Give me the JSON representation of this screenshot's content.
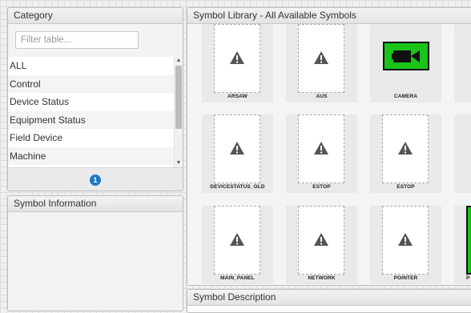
{
  "category": {
    "title": "Category",
    "filter_placeholder": "Filter table...",
    "items": [
      "ALL",
      "Control",
      "Device Status",
      "Equipment Status",
      "Field Device",
      "Machine"
    ],
    "page": "1"
  },
  "symbol_info": {
    "title": "Symbol Information"
  },
  "library": {
    "title": "Symbol Library - All Available Symbols",
    "symbols": [
      {
        "label": "ARSAW",
        "icon": "warning-icon"
      },
      {
        "label": "AUS",
        "icon": "warning-icon"
      },
      {
        "label": "CAMERA",
        "icon": "camera-icon"
      },
      {
        "label": "DEVICESTATUS_OLD",
        "icon": "warning-icon"
      },
      {
        "label": "ESTOP",
        "icon": "warning-icon"
      },
      {
        "label": "ESTOP",
        "icon": "warning-icon"
      },
      {
        "label": "MAIN_PANEL",
        "icon": "warning-icon"
      },
      {
        "label": "NETWORK",
        "icon": "warning-icon"
      },
      {
        "label": "POINTER",
        "icon": "warning-icon"
      },
      {
        "label": "P",
        "icon": "green-panel"
      }
    ]
  },
  "symbol_description": {
    "title": "Symbol Description"
  },
  "colors": {
    "accent": "#1f7bbf",
    "symbol_green": "#19c419"
  }
}
